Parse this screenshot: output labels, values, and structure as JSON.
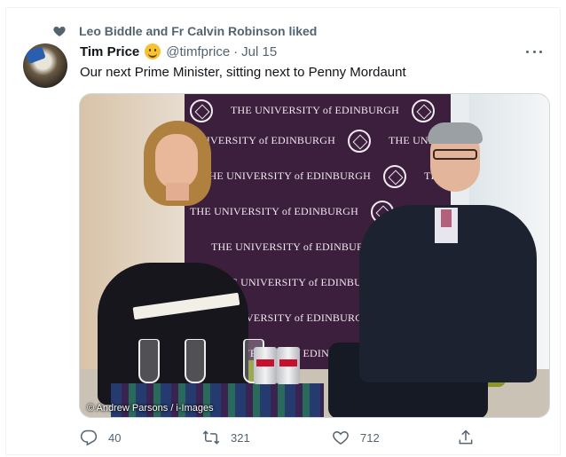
{
  "social_context": {
    "text": "Leo Biddle and Fr Calvin Robinson liked",
    "icon": "heart-icon"
  },
  "author": {
    "name": "Tim Price",
    "emoji": "smiling-face",
    "handle": "@timfprice",
    "separator": "·",
    "date": "Jul 15"
  },
  "tweet": {
    "text": "Our next Prime Minister, sitting next to Penny Mordaunt"
  },
  "photo": {
    "credit": "© Andrew Parsons / i-Images",
    "backdrop_text": "THE UNIVERSITY of EDINBURGH"
  },
  "actions": {
    "reply_count": "40",
    "retweet_count": "321",
    "like_count": "712"
  },
  "colors": {
    "secondary_text": "#536471",
    "primary_text": "#0f1419",
    "border": "#cfd9de"
  }
}
